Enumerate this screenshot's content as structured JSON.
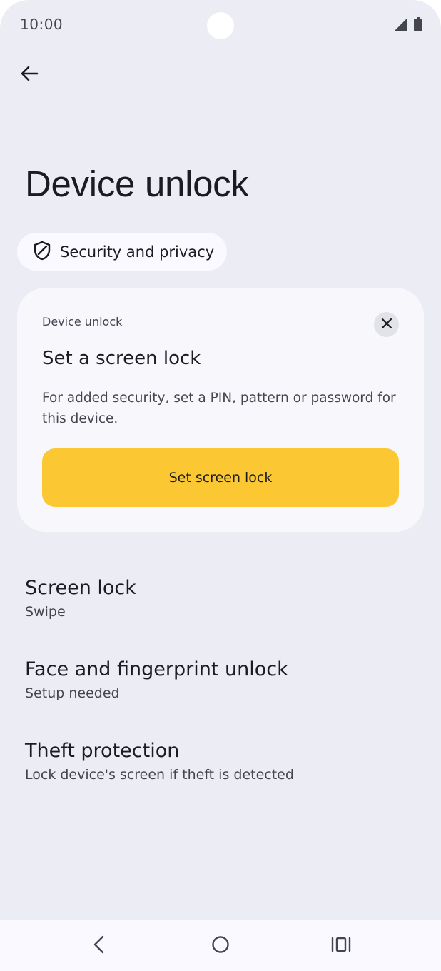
{
  "status_bar": {
    "time": "10:00"
  },
  "page": {
    "title": "Device unlock",
    "breadcrumb": "Security and privacy"
  },
  "card": {
    "kicker": "Device unlock",
    "title": "Set a screen lock",
    "body": "For added security, set a PIN, pattern or password for this device.",
    "action_label": "Set screen lock",
    "action_color": "#fbc834"
  },
  "settings": [
    {
      "title": "Screen lock",
      "summary": "Swipe"
    },
    {
      "title": "Face and fingerprint unlock",
      "summary": "Setup needed"
    },
    {
      "title": "Theft protection",
      "summary": "Lock device's screen if theft is detected"
    }
  ],
  "icons": {
    "back": "arrow-left-icon",
    "breadcrumb": "shield-icon",
    "close": "close-icon",
    "signal": "signal-icon",
    "battery": "battery-icon",
    "nav_back": "chevron-left-icon",
    "nav_home": "circle-home-icon",
    "nav_recents": "recents-icon"
  },
  "colors": {
    "background": "#ecedf4",
    "card": "#f7f7fc",
    "accent": "#fbc834"
  }
}
